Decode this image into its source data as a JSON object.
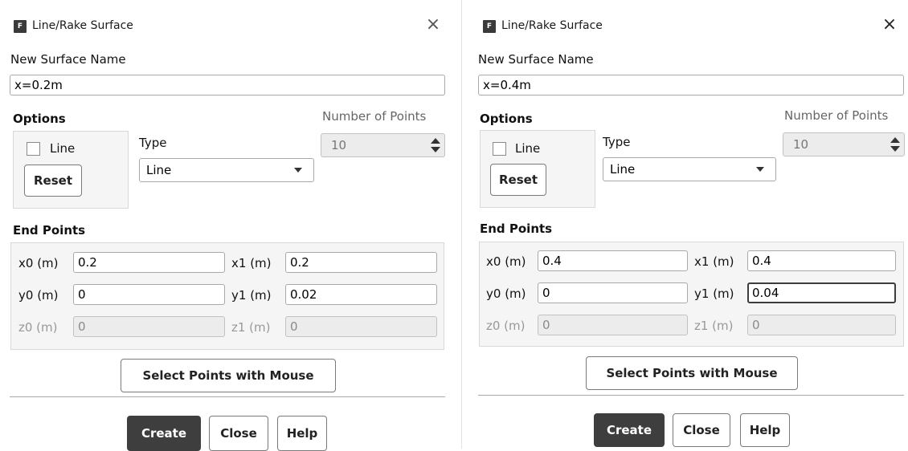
{
  "dialogs": [
    {
      "title": "Line/Rake Surface",
      "app_icon_letter": "F",
      "close_glyph": "×",
      "surface_name_label": "New Surface Name",
      "surface_name_value": "x=0.2m",
      "options_label": "Options",
      "line_checkbox_label": "Line",
      "line_checked": false,
      "reset_label": "Reset",
      "type_label": "Type",
      "type_value": "Line",
      "num_points_label": "Number of Points",
      "num_points_value": "10",
      "end_points_label": "End Points",
      "fields": {
        "x0_label": "x0 (m)",
        "x0_value": "0.2",
        "y0_label": "y0 (m)",
        "y0_value": "0",
        "z0_label": "z0 (m)",
        "z0_value": "0",
        "x1_label": "x1 (m)",
        "x1_value": "0.2",
        "y1_label": "y1 (m)",
        "y1_value": "0.02",
        "z1_label": "z1 (m)",
        "z1_value": "0"
      },
      "select_points_label": "Select Points with Mouse",
      "create_label": "Create",
      "close_label": "Close",
      "help_label": "Help"
    },
    {
      "title": "Line/Rake Surface",
      "app_icon_letter": "F",
      "close_glyph": "×",
      "surface_name_label": "New Surface Name",
      "surface_name_value": "x=0.4m",
      "options_label": "Options",
      "line_checkbox_label": "Line",
      "line_checked": false,
      "reset_label": "Reset",
      "type_label": "Type",
      "type_value": "Line",
      "num_points_label": "Number of Points",
      "num_points_value": "10",
      "end_points_label": "End Points",
      "fields": {
        "x0_label": "x0 (m)",
        "x0_value": "0.4",
        "y0_label": "y0 (m)",
        "y0_value": "0",
        "z0_label": "z0 (m)",
        "z0_value": "0",
        "x1_label": "x1 (m)",
        "x1_value": "0.4",
        "y1_label": "y1 (m)",
        "y1_value": "0.04",
        "z1_label": "z1 (m)",
        "z1_value": "0"
      },
      "select_points_label": "Select Points with Mouse",
      "create_label": "Create",
      "close_label": "Close",
      "help_label": "Help"
    }
  ],
  "colors": {
    "primary_button": "#3e3e3e",
    "group_background": "#f5f5f5",
    "disabled_field": "#ececec"
  }
}
